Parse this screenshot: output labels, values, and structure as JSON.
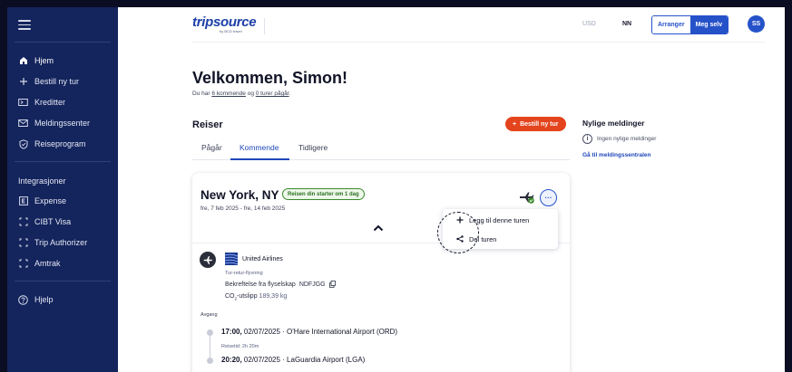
{
  "sidebar": {
    "items": [
      {
        "label": "Hjem",
        "icon": "home-icon",
        "active": true
      },
      {
        "label": "Bestill ny tur",
        "icon": "plus-icon"
      },
      {
        "label": "Kreditter",
        "icon": "ticket-icon"
      },
      {
        "label": "Meldingssenter",
        "icon": "mail-icon"
      },
      {
        "label": "Reiseprogram",
        "icon": "shield-check-icon"
      }
    ],
    "integrations_title": "Integrasjoner",
    "integrations": [
      {
        "label": "Expense",
        "icon": "expense-icon"
      },
      {
        "label": "CIBT Visa",
        "icon": "bracket-icon"
      },
      {
        "label": "Trip Authorizer",
        "icon": "bracket-icon"
      },
      {
        "label": "Amtrak",
        "icon": "bracket-icon"
      }
    ],
    "help": {
      "label": "Hjelp",
      "icon": "help-icon"
    }
  },
  "header": {
    "logo": "tripsource",
    "logo_sub": "by BCD travel",
    "currency": "USD",
    "language": "NN",
    "toggle": {
      "left": "Arranger",
      "right": "Meg selv",
      "selected": "Meg selv"
    },
    "avatar_initials": "SS"
  },
  "welcome": {
    "title": "Velkommen, Simon!",
    "prefix": "Du har ",
    "upcoming_link": "6 kommende",
    "middle": " og ",
    "ongoing_link": "0 turer pågår",
    "suffix": "."
  },
  "trips": {
    "title": "Reiser",
    "book_button": "Bestill ny tur",
    "tabs": [
      {
        "label": "Pågår"
      },
      {
        "label": "Kommende",
        "active": true
      },
      {
        "label": "Tidligere"
      }
    ]
  },
  "notifications": {
    "title": "Nylige meldinger",
    "empty": "Ingen nylige meldinger",
    "link": "Gå til meldingssentralen"
  },
  "trip_card": {
    "city": "New York, NY",
    "badge": "Reisen din starter om 1 dag",
    "dates": "fre, 7 feb 2025 - fre, 14 feb 2025",
    "menu": {
      "add": "Legg til denne turen",
      "share": "Del turen"
    },
    "flight": {
      "airline": "United Airlines",
      "type": "Tur-retur-flyvning",
      "pnr_label": "Bekreftelse fra flyselskap",
      "pnr": "NDFJGG",
      "co2_label_pre": "CO",
      "co2_label_sub": "2",
      "co2_label_post": "-utslipp",
      "co2_value": "189,39 kg",
      "direction": "Avgang",
      "depart_time": "17:00,",
      "depart_rest": " 02/07/2025 · O'Hare International Airport (ORD)",
      "duration": "Reisetid: 2h 20m",
      "arrive_time": "20:20,",
      "arrive_rest": " 02/07/2025 · LaGuardia Airport (LGA)"
    }
  },
  "colors": {
    "sidebar": "#14245c",
    "primary": "#2652c9",
    "accent": "#e3441d",
    "badge": "#3a8a2c"
  }
}
